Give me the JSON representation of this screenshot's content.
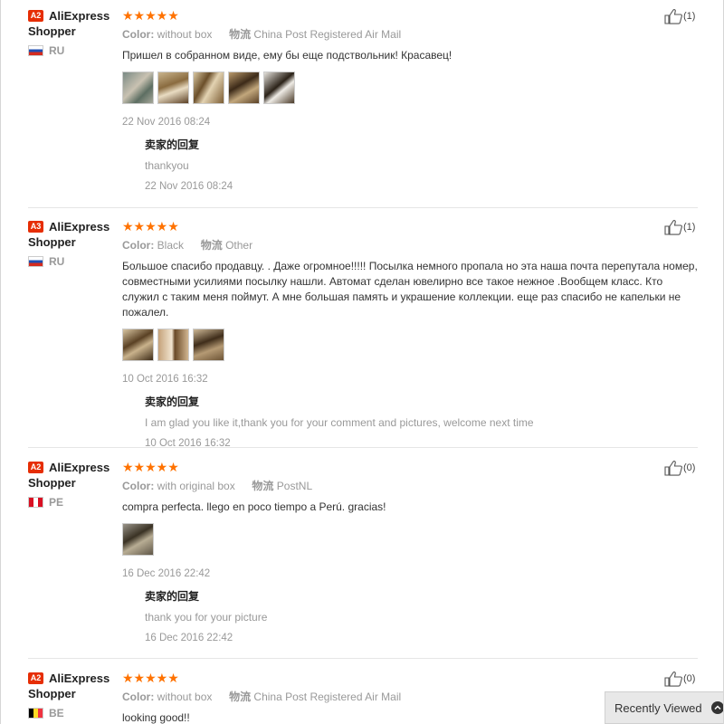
{
  "colors": {
    "accent": "#ff7200",
    "badge": "#e62e04"
  },
  "reviews": [
    {
      "badge": "A2",
      "user_line1": "AliExpress",
      "user_line2": "Shopper",
      "country": "RU",
      "stars": "★★★★★",
      "rating": 5,
      "color_label": "Color:",
      "color_value": "without box",
      "ship_label": "物流",
      "ship_value": "China Post Registered Air Mail",
      "text": "Пришел в собранном виде, ему бы еще подствольник! Красавец!",
      "photo_count": 5,
      "date": "22 Nov 2016 08:24",
      "reply_title": "卖家的回复",
      "reply_text": "thankyou",
      "reply_date": "22 Nov 2016 08:24",
      "likes": "(1)"
    },
    {
      "badge": "A3",
      "user_line1": "AliExpress",
      "user_line2": "Shopper",
      "country": "RU",
      "stars": "★★★★★",
      "rating": 5,
      "color_label": "Color:",
      "color_value": "Black",
      "ship_label": "物流",
      "ship_value": "Other",
      "text": "Большое спасибо продавцу. . Даже огромное!!!!! Посылка немного пропала но эта наша почта перепутала номер, совместными усилиями посылку нашли. Автомат сделан ювелирно все такое нежное .Вообщем класс. Кто служил с таким меня поймут. А мне большая память и украшение коллекции. еще раз спасибо не капельки не пожалел.",
      "photo_count": 3,
      "date": "10 Oct 2016 16:32",
      "reply_title": "卖家的回复",
      "reply_text": "I am glad you like it,thank you for your comment and pictures, welcome next time",
      "reply_date": "10 Oct 2016 16:32",
      "likes": "(1)"
    },
    {
      "badge": "A2",
      "user_line1": "AliExpress",
      "user_line2": "Shopper",
      "country": "PE",
      "stars": "★★★★★",
      "rating": 5,
      "color_label": "Color:",
      "color_value": "with original box",
      "ship_label": "物流",
      "ship_value": "PostNL",
      "text": "compra perfecta. llego en poco tiempo a Perú. gracias!",
      "photo_count": 1,
      "date": "16 Dec 2016 22:42",
      "reply_title": "卖家的回复",
      "reply_text": "thank you for your picture",
      "reply_date": "16 Dec 2016 22:42",
      "likes": "(0)"
    },
    {
      "badge": "A2",
      "user_line1": "AliExpress",
      "user_line2": "Shopper",
      "country": "BE",
      "stars": "★★★★★",
      "rating": 5,
      "color_label": "Color:",
      "color_value": "without box",
      "ship_label": "物流",
      "ship_value": "China Post Registered Air Mail",
      "text": "looking good!!",
      "likes": "(0)"
    }
  ],
  "recently_viewed": {
    "label": "Recently Viewed",
    "icon": "chevron-up-icon"
  }
}
